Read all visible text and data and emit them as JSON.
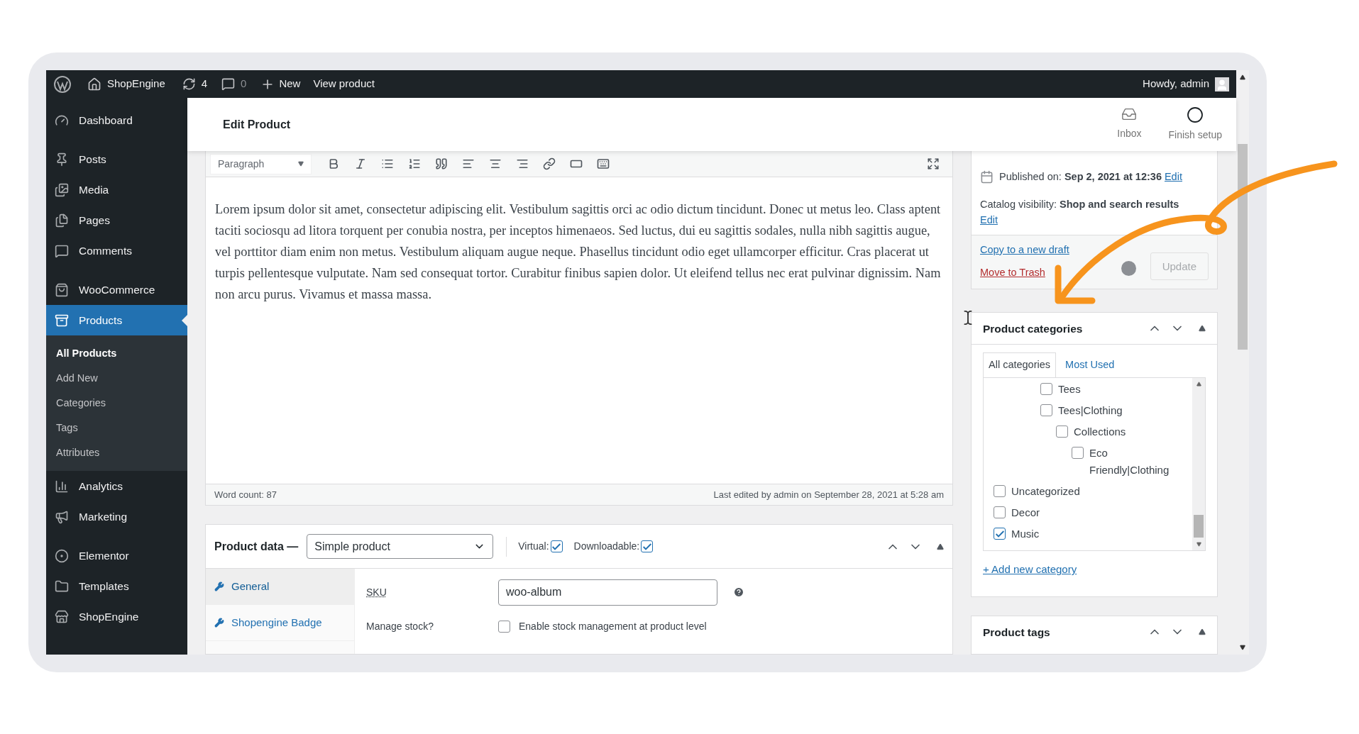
{
  "admin_bar": {
    "site": "ShopEngine",
    "updates": "4",
    "comments": "0",
    "new": "New",
    "view": "View product",
    "greeting": "Howdy, admin"
  },
  "sidebar": {
    "groups": [
      [
        {
          "label": "Dashboard",
          "selected": false
        }
      ],
      [
        {
          "label": "Posts",
          "selected": false
        },
        {
          "label": "Media",
          "selected": false
        },
        {
          "label": "Pages",
          "selected": false
        },
        {
          "label": "Comments",
          "selected": false
        }
      ],
      [
        {
          "label": "WooCommerce",
          "selected": false
        },
        {
          "label": "Products",
          "selected": true,
          "children": [
            {
              "label": "All Products",
              "selected": true
            },
            {
              "label": "Add New",
              "selected": false
            },
            {
              "label": "Categories",
              "selected": false
            },
            {
              "label": "Tags",
              "selected": false
            },
            {
              "label": "Attributes",
              "selected": false
            }
          ]
        },
        {
          "label": "Analytics",
          "selected": false
        },
        {
          "label": "Marketing",
          "selected": false
        }
      ],
      [
        {
          "label": "Elementor",
          "selected": false
        },
        {
          "label": "Templates",
          "selected": false
        },
        {
          "label": "ShopEngine",
          "selected": false
        }
      ]
    ]
  },
  "header": {
    "title": "Edit Product",
    "actions": [
      "Inbox",
      "Finish setup"
    ]
  },
  "editor": {
    "format": "Paragraph",
    "body": "Lorem ipsum dolor sit amet, consectetur adipiscing elit. Vestibulum sagittis orci ac odio dictum tincidunt. Donec ut metus leo. Class aptent taciti sociosqu ad litora torquent per conubia nostra, per inceptos himenaeos. Sed luctus, dui eu sagittis sodales, nulla nibh sagittis augue, vel porttitor diam enim non metus. Vestibulum aliquam augue neque. Phasellus tincidunt odio eget ullamcorper efficitur. Cras placerat ut turpis pellentesque vulputate. Nam sed consequat tortor. Curabitur finibus sapien dolor. Ut eleifend tellus nec erat pulvinar dignissim. Nam non arcu purus. Vivamus et massa massa.",
    "word_count": "Word count: 87",
    "last_edited": "Last edited by admin on September 28, 2021 at 5:28 am"
  },
  "product_data": {
    "label": "Product data —",
    "type": "Simple product",
    "options": [
      {
        "label": "Virtual:",
        "checked": true
      },
      {
        "label": "Downloadable:",
        "checked": true
      }
    ],
    "tabs": [
      {
        "label": "General",
        "selected": true
      },
      {
        "label": "Shopengine Badge",
        "selected": false
      }
    ],
    "sku": {
      "label": "SKU",
      "value": "woo-album"
    },
    "manage_stock": {
      "label": "Manage stock?",
      "text": "Enable stock management at product level",
      "checked": false
    }
  },
  "publish": {
    "published": "Published on: **Sep 2, 2021 at 12:36**",
    "published_edit": "Edit",
    "visibility": "Catalog visibility: **Shop and search results**",
    "visibility_edit": "Edit",
    "copy": "Copy to a new draft",
    "trash": "Move to Trash",
    "update": "Update"
  },
  "categories": {
    "title": "Product categories",
    "tabs": [
      {
        "label": "All categories",
        "selected": true
      },
      {
        "label": "Most Used",
        "selected": false
      }
    ],
    "items": [
      {
        "children": [
          {
            "children": [
              {
                "children": [
                  {
                    "label": "Tees",
                    "checked": false
                  },
                  {
                    "label": "Tees|Clothing",
                    "checked": false,
                    "children": [
                      {
                        "label": "Collections",
                        "checked": false,
                        "children": [
                          {
                            "label": "Eco Friendly|Clothing",
                            "checked": false
                          }
                        ]
                      }
                    ]
                  }
                ]
              }
            ]
          }
        ]
      },
      {
        "label": "Uncategorized",
        "checked": false
      },
      {
        "label": "Decor",
        "checked": false
      },
      {
        "label": "Music",
        "checked": true
      }
    ],
    "add": "+ Add new category"
  },
  "tags": {
    "title": "Product tags"
  }
}
